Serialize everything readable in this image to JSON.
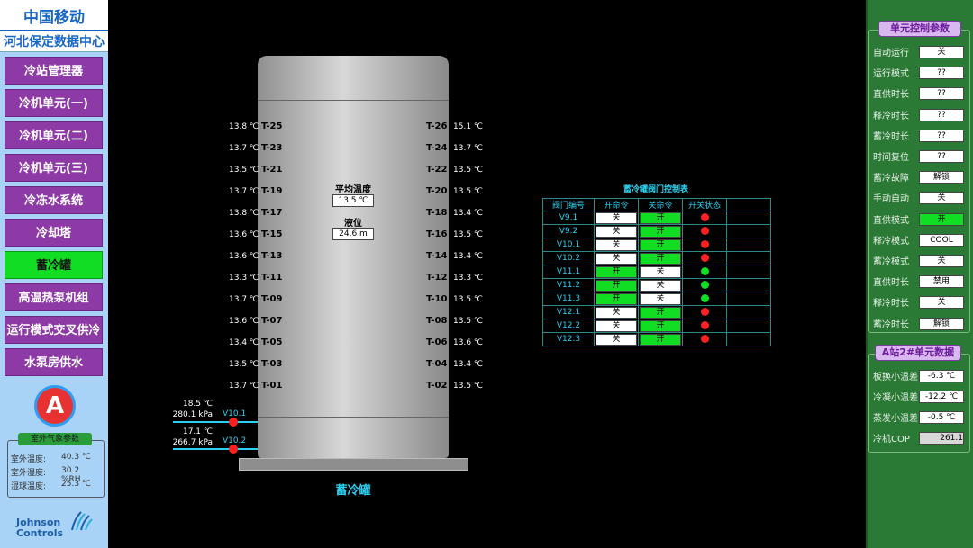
{
  "brand": {
    "line1": "中国移动",
    "line2": "河北保定数据中心"
  },
  "nav": [
    {
      "label": "冷站管理器",
      "active": false
    },
    {
      "label": "冷机单元(一)",
      "active": false
    },
    {
      "label": "冷机单元(二)",
      "active": false
    },
    {
      "label": "冷机单元(三)",
      "active": false
    },
    {
      "label": "冷冻水系统",
      "active": false
    },
    {
      "label": "冷却塔",
      "active": false
    },
    {
      "label": "蓄冷罐",
      "active": true
    },
    {
      "label": "高温热泵机组",
      "active": false
    },
    {
      "label": "运行模式交叉供冷",
      "active": false
    },
    {
      "label": "水泵房供水",
      "active": false
    }
  ],
  "badge": "A",
  "outdoor": {
    "title": "室外气象参数",
    "rows": [
      {
        "label": "室外温度:",
        "value": "40.3 ℃"
      },
      {
        "label": "室外湿度:",
        "value": "30.2 %RH"
      },
      {
        "label": "湿球温度:",
        "value": "25.3 ℃"
      }
    ]
  },
  "logo": {
    "line1": "Johnson",
    "line2": "Controls"
  },
  "tank": {
    "label": "蓄冷罐",
    "avg_temp_label": "平均温度",
    "avg_temp": "13.5 ℃",
    "level_label": "液位",
    "level": "24.6 m",
    "left_sensors": [
      {
        "name": "T-25",
        "temp": "13.8 ℃"
      },
      {
        "name": "T-23",
        "temp": "13.7 ℃"
      },
      {
        "name": "T-21",
        "temp": "13.5 ℃"
      },
      {
        "name": "T-19",
        "temp": "13.7 ℃"
      },
      {
        "name": "T-17",
        "temp": "13.8 ℃"
      },
      {
        "name": "T-15",
        "temp": "13.6 ℃"
      },
      {
        "name": "T-13",
        "temp": "13.6 ℃"
      },
      {
        "name": "T-11",
        "temp": "13.3 ℃"
      },
      {
        "name": "T-09",
        "temp": "13.7 ℃"
      },
      {
        "name": "T-07",
        "temp": "13.6 ℃"
      },
      {
        "name": "T-05",
        "temp": "13.4 ℃"
      },
      {
        "name": "T-03",
        "temp": "13.5 ℃"
      },
      {
        "name": "T-01",
        "temp": "13.7 ℃"
      }
    ],
    "right_sensors": [
      {
        "name": "T-26",
        "temp": "15.1 ℃"
      },
      {
        "name": "T-24",
        "temp": "13.7 ℃"
      },
      {
        "name": "T-22",
        "temp": "13.5 ℃"
      },
      {
        "name": "T-20",
        "temp": "13.5 ℃"
      },
      {
        "name": "T-18",
        "temp": "13.4 ℃"
      },
      {
        "name": "T-16",
        "temp": "13.5 ℃"
      },
      {
        "name": "T-14",
        "temp": "13.4 ℃"
      },
      {
        "name": "T-12",
        "temp": "13.3 ℃"
      },
      {
        "name": "T-10",
        "temp": "13.5 ℃"
      },
      {
        "name": "T-08",
        "temp": "13.5 ℃"
      },
      {
        "name": "T-06",
        "temp": "13.6 ℃"
      },
      {
        "name": "T-04",
        "temp": "13.4 ℃"
      },
      {
        "name": "T-02",
        "temp": "13.5 ℃"
      }
    ],
    "pipes": [
      {
        "temp": "18.5 ℃",
        "pressure": "280.1 kPa",
        "valve": "V10.1"
      },
      {
        "temp": "17.1 ℃",
        "pressure": "266.7 kPa",
        "valve": "V10.2"
      }
    ]
  },
  "valve_table": {
    "title": "蓄冷罐阀门控制表",
    "headers": [
      "阀门编号",
      "开命令",
      "关命令",
      "开关状态"
    ],
    "rows": [
      {
        "id": "V9.1",
        "open": "关",
        "open_on": false,
        "close": "开",
        "close_on": true,
        "status": "red"
      },
      {
        "id": "V9.2",
        "open": "关",
        "open_on": false,
        "close": "开",
        "close_on": true,
        "status": "red"
      },
      {
        "id": "V10.1",
        "open": "关",
        "open_on": false,
        "close": "开",
        "close_on": true,
        "status": "red"
      },
      {
        "id": "V10.2",
        "open": "关",
        "open_on": false,
        "close": "开",
        "close_on": true,
        "status": "red"
      },
      {
        "id": "V11.1",
        "open": "开",
        "open_on": true,
        "close": "关",
        "close_on": false,
        "status": "green"
      },
      {
        "id": "V11.2",
        "open": "开",
        "open_on": true,
        "close": "关",
        "close_on": false,
        "status": "green"
      },
      {
        "id": "V11.3",
        "open": "开",
        "open_on": true,
        "close": "关",
        "close_on": false,
        "status": "green"
      },
      {
        "id": "V12.1",
        "open": "关",
        "open_on": false,
        "close": "开",
        "close_on": true,
        "status": "red"
      },
      {
        "id": "V12.2",
        "open": "关",
        "open_on": false,
        "close": "开",
        "close_on": true,
        "status": "red"
      },
      {
        "id": "V12.3",
        "open": "关",
        "open_on": false,
        "close": "开",
        "close_on": true,
        "status": "red"
      }
    ],
    "colors": {
      "red": "#ff2020",
      "green": "#11dd22"
    }
  },
  "unit_params": {
    "title": "单元控制参数",
    "rows": [
      {
        "label": "自动运行",
        "value": "关"
      },
      {
        "label": "运行模式",
        "value": "??"
      },
      {
        "label": "直供时长",
        "value": "??"
      },
      {
        "label": "释冷时长",
        "value": "??"
      },
      {
        "label": "蓄冷时长",
        "value": "??"
      },
      {
        "label": "时间复位",
        "value": "??"
      },
      {
        "label": "蓄冷故障",
        "value": "解锁"
      },
      {
        "label": "手动自动",
        "value": "关"
      },
      {
        "label": "直供模式",
        "value": "开",
        "highlight": true
      },
      {
        "label": "释冷模式",
        "value": "COOL"
      },
      {
        "label": "蓄冷模式",
        "value": "关"
      },
      {
        "label": "直供时长",
        "value": "禁用"
      },
      {
        "label": "释冷时长",
        "value": "关"
      },
      {
        "label": "蓄冷时长",
        "value": "解锁"
      }
    ]
  },
  "unit_data": {
    "title": "A站2#单元数据",
    "rows": [
      {
        "label": "板换小温差",
        "value": "-6.3 ℃"
      },
      {
        "label": "冷凝小温差",
        "value": "-12.2 ℃"
      },
      {
        "label": "蒸发小温差",
        "value": "-0.5 ℃"
      },
      {
        "label": "冷机COP",
        "value": "261.1"
      }
    ]
  }
}
